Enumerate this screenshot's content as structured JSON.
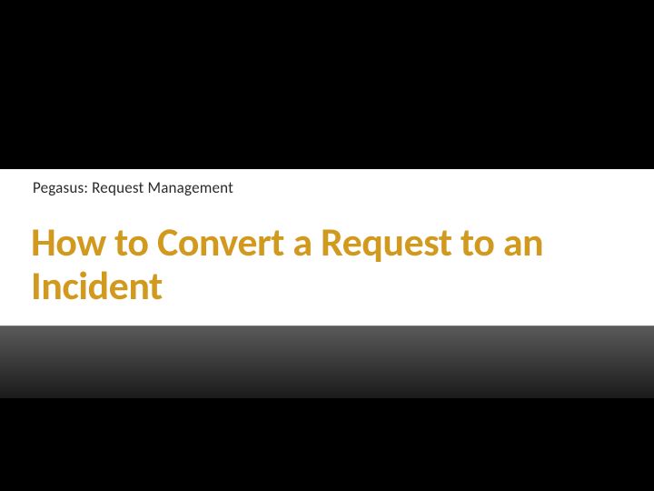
{
  "slide": {
    "subtitle": "Pegasus: Request Management",
    "title": "How to Convert a Request to an Incident"
  },
  "colors": {
    "background": "#000000",
    "band": "#ffffff",
    "title": "#d19a1f",
    "subtitle": "#2a2a2a"
  }
}
